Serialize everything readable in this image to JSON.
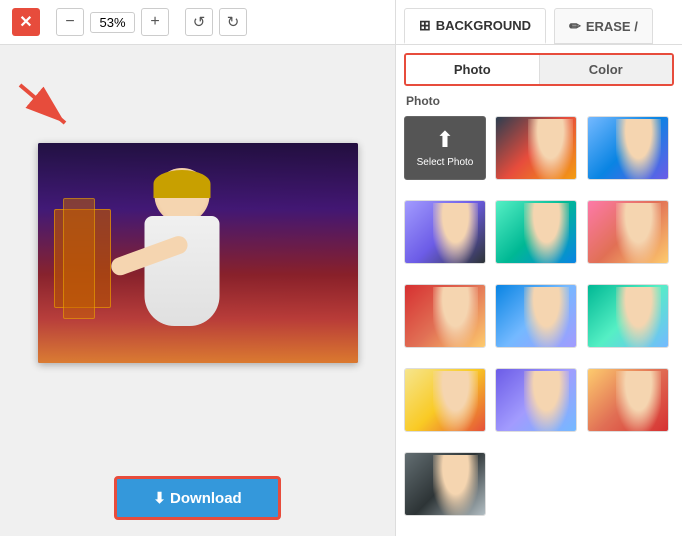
{
  "toolbar": {
    "close_label": "✕",
    "zoom_minus_label": "−",
    "zoom_value": "53%",
    "zoom_plus_label": "+",
    "undo_label": "↺",
    "redo_label": "↻"
  },
  "download": {
    "label": "⬇ Download"
  },
  "right_panel": {
    "tab_background_label": "BACKGROUND",
    "tab_erase_label": "ERASE /",
    "sub_tab_photo_label": "Photo",
    "sub_tab_color_label": "Color",
    "photo_section_label": "Photo",
    "select_photo_label": "Select Photo"
  },
  "photos": [
    {
      "id": 1,
      "bg": "bg-1"
    },
    {
      "id": 2,
      "bg": "bg-2"
    },
    {
      "id": 3,
      "bg": "bg-3"
    },
    {
      "id": 4,
      "bg": "bg-4"
    },
    {
      "id": 5,
      "bg": "bg-5"
    },
    {
      "id": 6,
      "bg": "bg-6"
    },
    {
      "id": 7,
      "bg": "bg-7"
    },
    {
      "id": 8,
      "bg": "bg-8"
    },
    {
      "id": 9,
      "bg": "bg-9"
    },
    {
      "id": 10,
      "bg": "bg-10"
    },
    {
      "id": 11,
      "bg": "bg-11"
    },
    {
      "id": 12,
      "bg": "bg-12"
    }
  ]
}
